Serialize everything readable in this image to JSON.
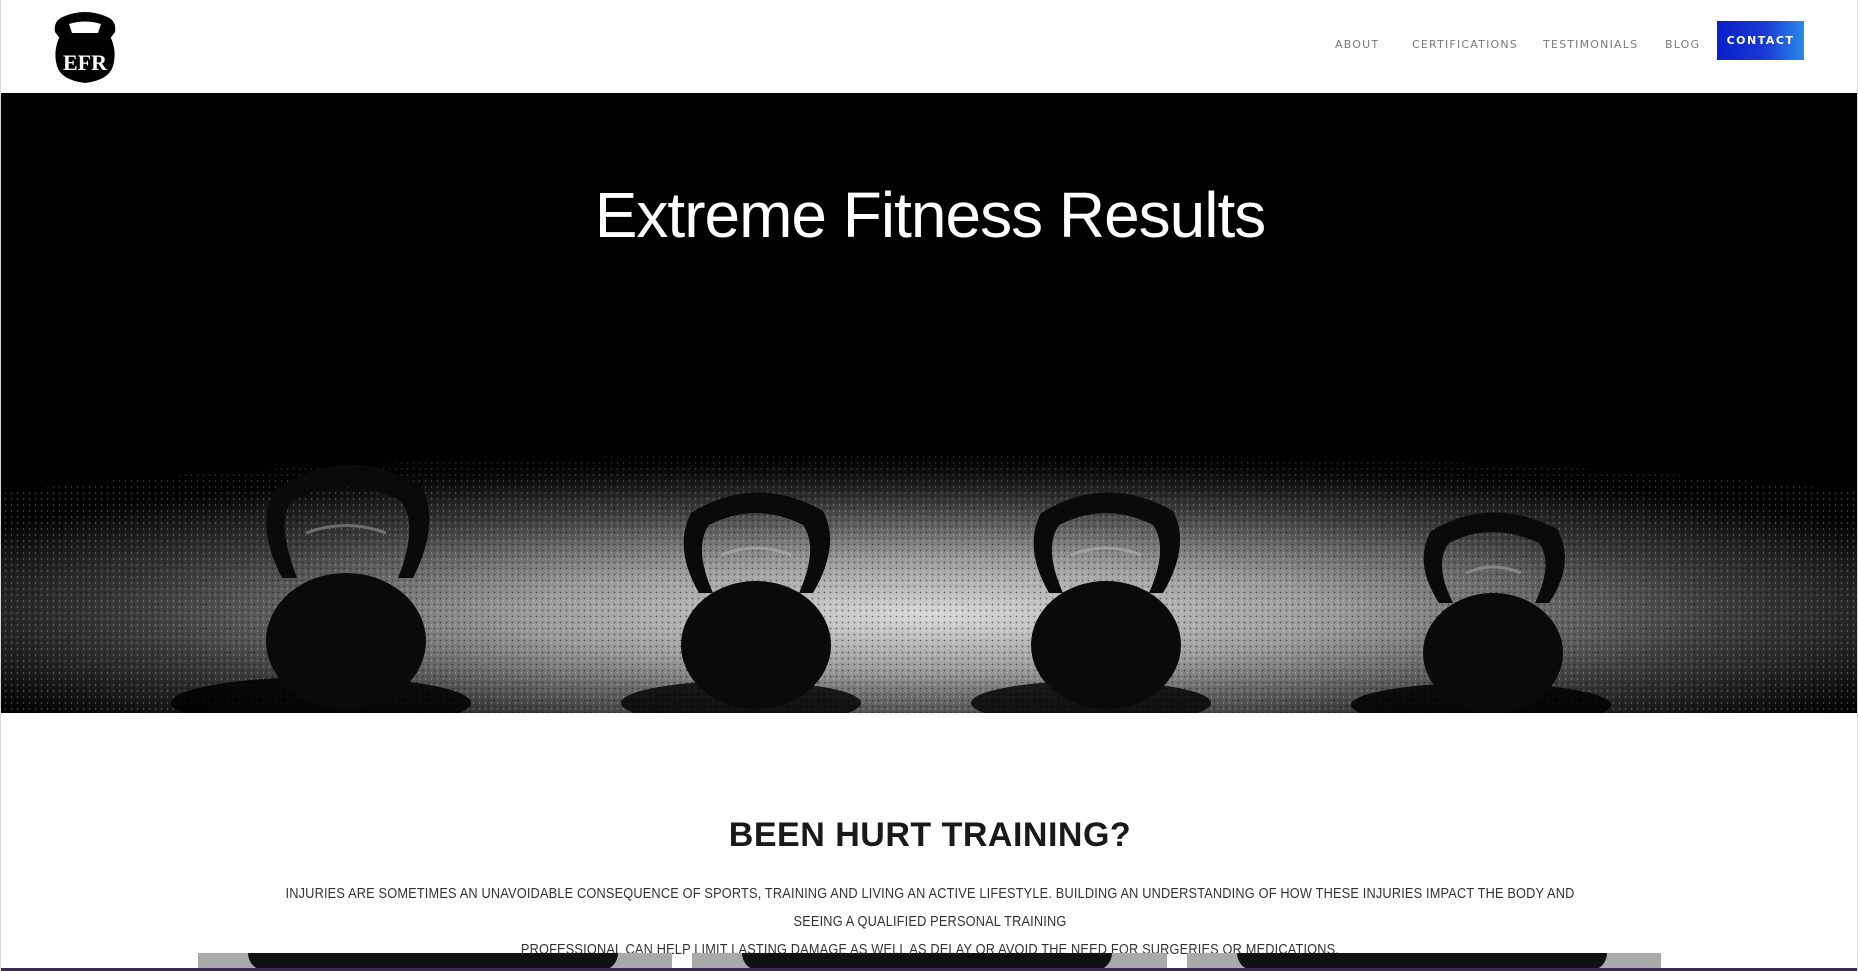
{
  "header": {
    "logo_text": "EFR",
    "nav": {
      "about": "ABOUT",
      "certifications": "CERTIFICATIONS",
      "testimonials": "TESTIMONIALS",
      "blog": "BLOG",
      "contact": "CONTACT"
    }
  },
  "hero": {
    "title": "Extreme Fitness Results"
  },
  "section": {
    "title": "BEEN HURT TRAINING?",
    "line1": "INJURIES ARE SOMETIMES AN UNAVOIDABLE CONSEQUENCE OF SPORTS, TRAINING AND LIVING AN ACTIVE LIFESTYLE. BUILDING AN UNDERSTANDING OF HOW THESE INJURIES IMPACT THE BODY AND SEEING A QUALIFIED PERSONAL TRAINING",
    "line2": "PROFESSIONAL CAN HELP LIMIT LASTING DAMAGE AS WELL AS DELAY OR AVOID THE NEED FOR SURGERIES OR MEDICATIONS."
  },
  "colors": {
    "contact_button": "#1a3ad4",
    "nav_text": "#7a7a7a",
    "hero_background": "#000000"
  }
}
